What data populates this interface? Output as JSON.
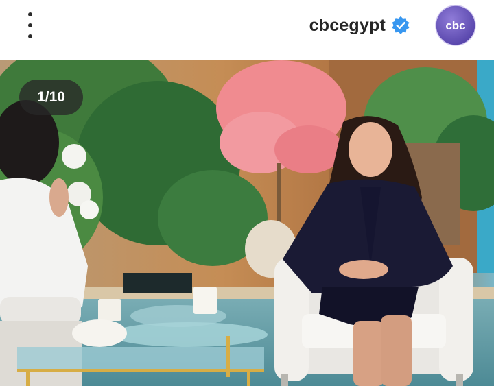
{
  "header": {
    "username": "cbcegypt",
    "menu_icon": "more-vertical-icon",
    "verified_icon": "verified-badge-icon",
    "avatar_text": "cbc",
    "avatar_color": "#6b57b8"
  },
  "post": {
    "counter_text": "1/10",
    "image_subject": "tv-studio-talk-show-photo"
  },
  "colors": {
    "verified_blue": "#3897f0",
    "counter_bg": "#282828"
  }
}
